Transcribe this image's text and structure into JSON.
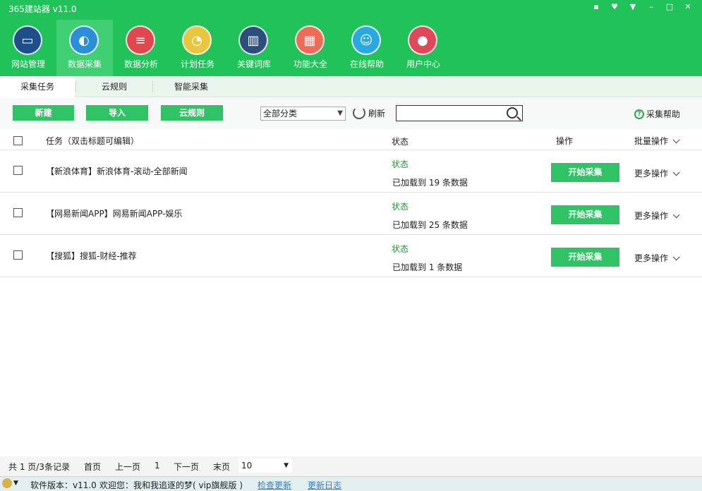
{
  "app": {
    "title": "365建站器 v11.0"
  },
  "window_controls": [
    {
      "name": "feedback-icon",
      "glyph": "▪"
    },
    {
      "name": "skin-icon",
      "glyph": "♥"
    },
    {
      "name": "menu-icon",
      "glyph": "▼"
    },
    {
      "name": "minimize-icon",
      "glyph": "–"
    },
    {
      "name": "maximize-icon",
      "glyph": "□"
    },
    {
      "name": "close-icon",
      "glyph": "✕"
    }
  ],
  "nav": {
    "items": [
      {
        "label": "网站管理",
        "icon": "monitor-icon",
        "color": "#1f4f8a",
        "glyph": "▭"
      },
      {
        "label": "数据采集",
        "icon": "globe-icon",
        "color": "#2a8fd6",
        "glyph": "◐"
      },
      {
        "label": "数据分析",
        "icon": "database-icon",
        "color": "#e0484f",
        "glyph": "≡"
      },
      {
        "label": "计划任务",
        "icon": "gauge-icon",
        "color": "#e8c640",
        "glyph": "◔"
      },
      {
        "label": "关键词库",
        "icon": "book-icon",
        "color": "#2b4e7a",
        "glyph": "▥"
      },
      {
        "label": "功能大全",
        "icon": "grid-icon",
        "color": "#f06a58",
        "glyph": "▦"
      },
      {
        "label": "在线帮助",
        "icon": "headset-icon",
        "color": "#2aa8e0",
        "glyph": "☺"
      },
      {
        "label": "用户中心",
        "icon": "user-icon",
        "color": "#e0485a",
        "glyph": "●"
      }
    ],
    "active_index": 1
  },
  "tabs": [
    {
      "label": "采集任务"
    },
    {
      "label": "云规则"
    },
    {
      "label": "智能采集"
    }
  ],
  "toolbar": {
    "new_label": "新建",
    "import_label": "导入",
    "cloud_rule_label": "云规则",
    "category_selected": "全部分类",
    "refresh_label": "刷新",
    "search_value": "",
    "help_label": "采集帮助"
  },
  "table": {
    "headers": {
      "task": "任务（双击标题可编辑）",
      "status": "状态",
      "action": "操作",
      "batch": "批量操作"
    },
    "rows": [
      {
        "name": "【新浪体育】新浪体育-滚动-全部新闻",
        "status_label": "状态",
        "status_text": "已加载到 19 条数据",
        "start_label": "开始采集",
        "more_label": "更多操作"
      },
      {
        "name": "【网易新闻APP】网易新闻APP-娱乐",
        "status_label": "状态",
        "status_text": "已加载到 25 条数据",
        "start_label": "开始采集",
        "more_label": "更多操作"
      },
      {
        "name": "【搜狐】搜狐-财经-推荐",
        "status_label": "状态",
        "status_text": "已加载到 1 条数据",
        "start_label": "开始采集",
        "more_label": "更多操作"
      }
    ]
  },
  "pager": {
    "summary": "共 1 页/3条记录",
    "first": "首页",
    "prev": "上一页",
    "current": "1",
    "next": "下一页",
    "last": "末页",
    "page_size": "10"
  },
  "statusbar": {
    "version": "软件版本：v11.0",
    "welcome": "欢迎您：我和我追逐的梦( vip旗舰版 )",
    "check_update": "检查更新",
    "changelog": "更新日志"
  },
  "colors": {
    "brand_green": "#22c25a",
    "button_green": "#2fc365",
    "status_green": "#2e8b3c"
  }
}
